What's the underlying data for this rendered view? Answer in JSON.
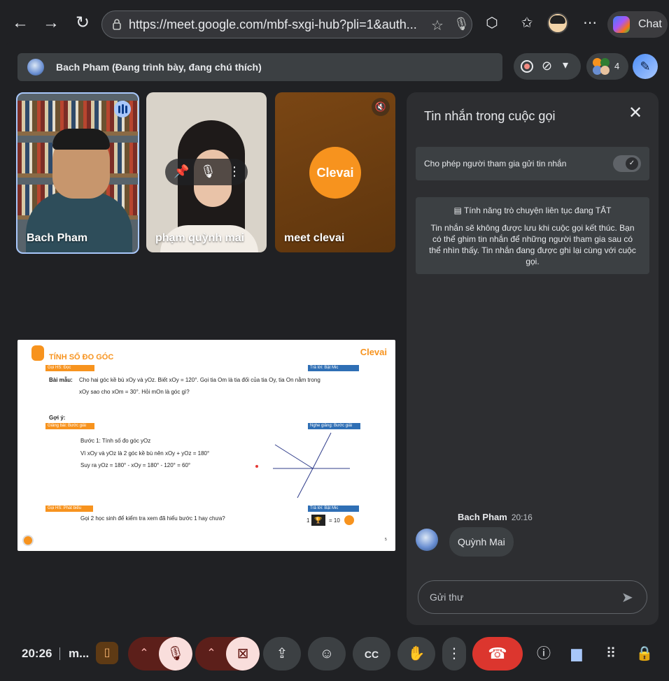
{
  "browser": {
    "url": "https://meet.google.com/mbf-sxgi-hub?pli=1&auth...",
    "chat_label": "Chat"
  },
  "banner": {
    "presenting_text": "Bach Pham (Đang trình bày, đang chú thích)",
    "participant_count": "4"
  },
  "tiles": [
    {
      "name": "Bach Pham"
    },
    {
      "name": "phạm quỳnh mai"
    },
    {
      "name": "meet clevai",
      "logo_text": "Clevai"
    }
  ],
  "slide": {
    "title": "TÍNH SỐ ĐO GÓC",
    "brand": "Clevai",
    "tag_goi_doc": "Gọi HS: Đọc",
    "tag_tra_loi_1": "Trả lời: Bật Mic",
    "bai_mau_label": "Bài mẫu:",
    "bai_mau_line1": "Cho hai góc kề bù xOy và yOz. Biết xOy = 120°. Gọi tia Om là tia đối của tia Oy, tia On nằm trong",
    "bai_mau_line2": "xOy sao cho xOm = 30°. Hỏi mOn là góc gì?",
    "goi_y": "Gợi ý:",
    "tag_giang_bai": "Giảng bài: Bước giải",
    "tag_nghe_giang": "Nghe giảng: Bước giải",
    "step1": "Bước 1: Tính số đo góc yOz",
    "step2": "Vì xOy và yOz là 2 góc kề bù nên xOy + yOz = 180°",
    "step3": "Suy ra yOz = 180° - xOy = 180°  - 120° = 60°",
    "tag_phat_bieu": "Gọi HS: Phát biểu",
    "tag_tra_loi_2": "Trả lời: Bật Mic",
    "question": "Gọi 2 học sinh để kiểm tra xem đã hiểu bước 1 hay chưa?",
    "score_left": "1",
    "score_right": "= 10",
    "page_no": "5"
  },
  "panel": {
    "title": "Tin nhắn trong cuộc gọi",
    "allow_label": "Cho phép người tham gia gửi tin nhắn",
    "continuous_head": "Tính năng trò chuyện liên tục đang TẮT",
    "continuous_body": "Tin nhắn sẽ không được lưu khi cuộc gọi kết thúc. Bạn có thể ghim tin nhắn để những người tham gia sau có thể nhìn thấy. Tin nhắn đang được ghi lại cùng với cuộc gọi.",
    "message_sender": "Bach Pham",
    "message_time": "20:16",
    "message_text": "Quỳnh Mai",
    "input_placeholder": "Gửi thư"
  },
  "bottombar": {
    "time": "20:26",
    "meeting_title": "m..."
  }
}
